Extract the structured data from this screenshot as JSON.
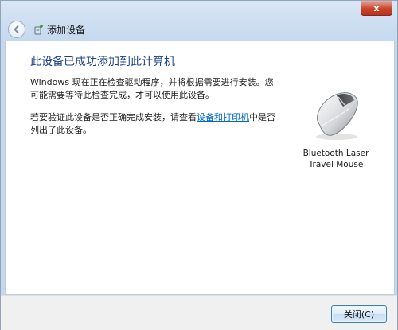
{
  "window": {
    "title": "添加设备",
    "close_label": "x"
  },
  "main": {
    "heading": "此设备已成功添加到此计算机",
    "para1": "Windows 现在正在检查驱动程序，并将根据需要进行安装。您可能需要等待此检查完成，才可以使用此设备。",
    "para2_prefix": "若要验证此设备是否正确完成安装，请查看",
    "para2_link": "设备和打印机",
    "para2_suffix": "中是否列出了此设备。"
  },
  "device": {
    "name_line1": "Bluetooth Laser",
    "name_line2": "Travel Mouse",
    "icon": "mouse-icon"
  },
  "footer": {
    "close_button": "关闭(C)"
  },
  "colors": {
    "heading": "#1e3f8a",
    "link": "#0066cc",
    "close_button": "#c8432b"
  }
}
